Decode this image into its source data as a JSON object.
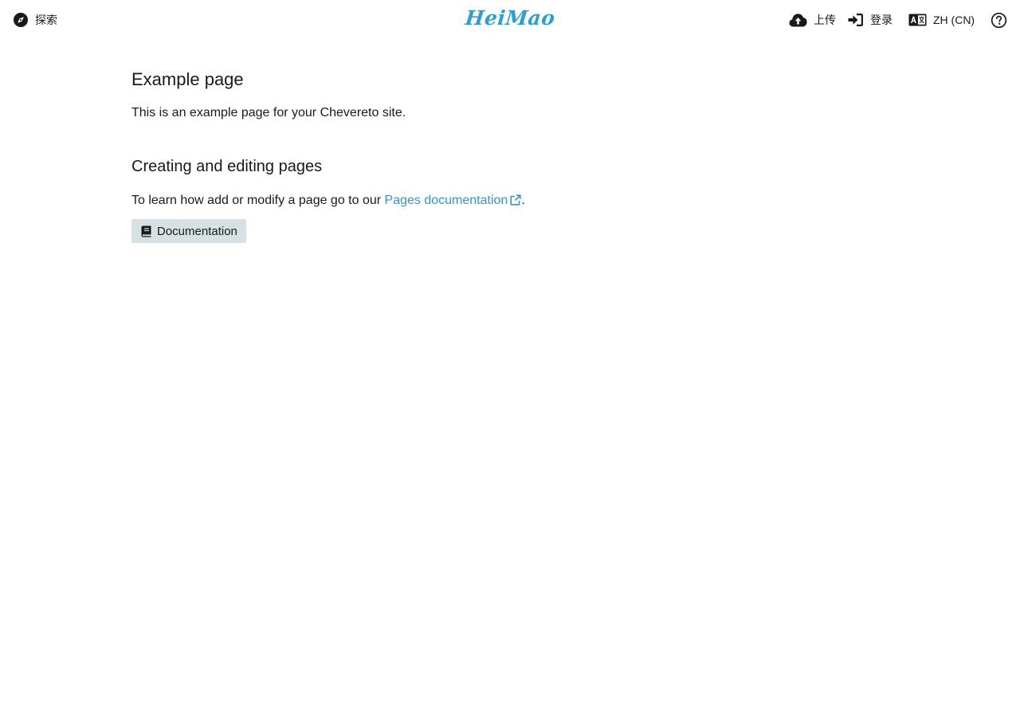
{
  "header": {
    "explore_label": "探索",
    "logo_text": "HeiMao",
    "upload_label": "上传",
    "login_label": "登录",
    "language_label": "ZH (CN)"
  },
  "main": {
    "title": "Example page",
    "intro": "This is an example page for your Chevereto site.",
    "section_title": "Creating and editing pages",
    "howto_prefix": "To learn how add or modify a page go to our ",
    "howto_link": "Pages documentation",
    "howto_suffix": ".",
    "button_label": "Documentation"
  },
  "colors": {
    "accent": "#2b9fd4",
    "link": "#2f96cf",
    "button_bg": "#d7e0e2",
    "text": "#1a1a1a"
  },
  "icons": {
    "explore": "compass-icon",
    "upload": "cloud-upload-icon",
    "login": "sign-in-icon",
    "language": "language-icon",
    "help": "question-circle-icon",
    "external_link": "external-link-icon",
    "documentation": "book-icon"
  }
}
